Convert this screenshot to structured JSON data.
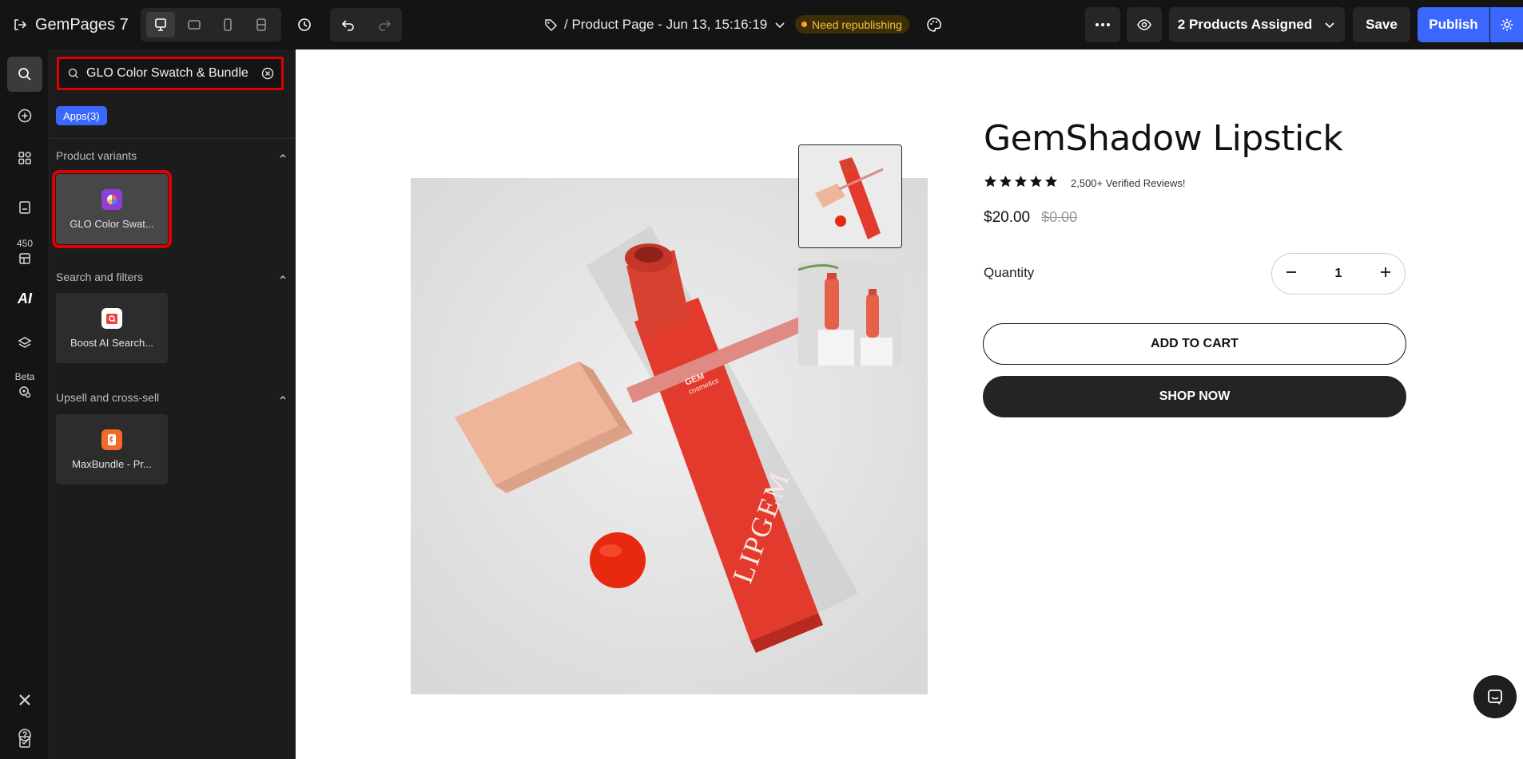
{
  "topbar": {
    "brand": "GemPages 7",
    "page_title": "/ Product Page - Jun 13, 15:16:19",
    "status": "Need republishing",
    "assigned": "2 Products Assigned",
    "save": "Save",
    "publish": "Publish"
  },
  "rail": {
    "badge_count": "450",
    "ai_label": "AI",
    "beta_label": "Beta"
  },
  "panel": {
    "search_value": "GLO Color Swatch & Bundle",
    "apps_chip": "Apps(3)",
    "categories": [
      {
        "title": "Product variants",
        "app": "GLO Color Swat..."
      },
      {
        "title": "Search and filters",
        "app": "Boost AI Search..."
      },
      {
        "title": "Upsell and cross-sell",
        "app": "MaxBundle - Pr..."
      }
    ]
  },
  "product": {
    "title": "GemShadow Lipstick",
    "reviews": "2,500+ Verified Reviews!",
    "rating": 5,
    "price": "$20.00",
    "compare_price": "$0.00",
    "quantity_label": "Quantity",
    "quantity": "1",
    "add_to_cart": "ADD TO CART",
    "shop_now": "SHOP NOW",
    "box_brand": "LIPGEM",
    "cap_brand": "GEM",
    "cap_brand_sub": "cosmetics"
  },
  "colors": {
    "accent": "#3c67ff",
    "highlight": "#e00000",
    "topbar_bg": "#141414",
    "panel_bg": "#1c1c1c",
    "lipstick_red": "#e23a2c",
    "cap_peach": "#eeb59b"
  }
}
